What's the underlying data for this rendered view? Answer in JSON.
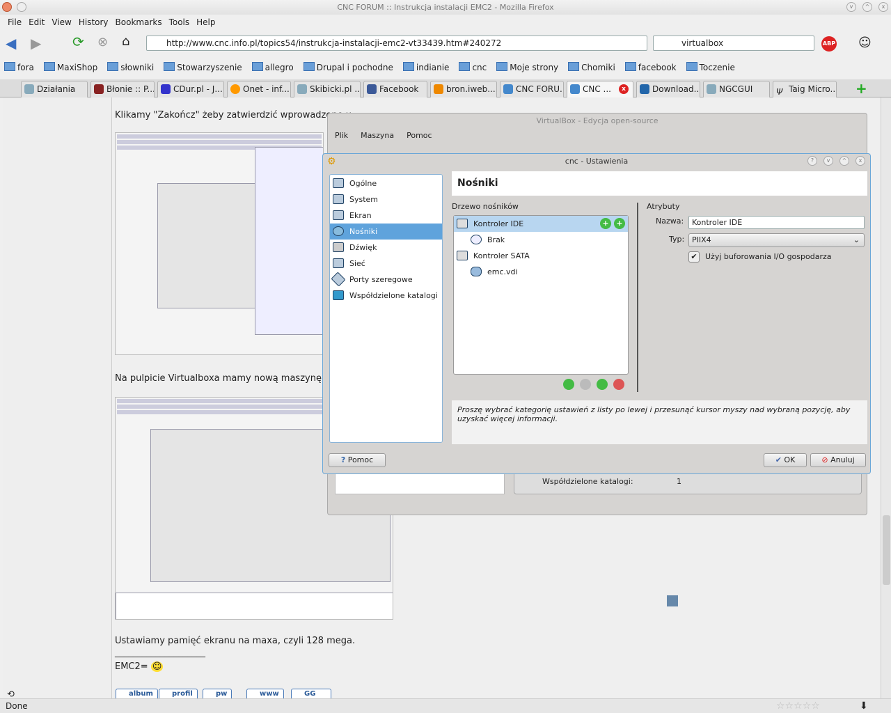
{
  "window": {
    "title": "CNC FORUM :: Instrukcja instalacji EMC2 - Mozilla Firefox"
  },
  "menu": [
    "File",
    "Edit",
    "View",
    "History",
    "Bookmarks",
    "Tools",
    "Help"
  ],
  "nav": {
    "url": "http://www.cnc.info.pl/topics54/instrukcja-instalacji-emc2-vt33439.htm#240272",
    "search": "virtualbox"
  },
  "bookmarks": [
    "fora",
    "MaxiShop",
    "słowniki",
    "Stowarzyszenie",
    "allegro",
    "Drupal i pochodne",
    "indianie",
    "cnc",
    "Moje strony",
    "Chomiki",
    "facebook",
    "Toczenie"
  ],
  "tabs": [
    "Działania",
    "Błonie :: P...",
    "CDur.pl - J...",
    "Onet - inf...",
    "Skibicki.pl ...",
    "Facebook",
    "bron.iweb....",
    "CNC FORU...",
    "CNC ...",
    "Download...",
    "NGCGUI",
    "Taig Micro..."
  ],
  "post": {
    "line1": "Klikamy \"Zakończ\" żeby zatwierdzić wprowadzone u",
    "line2": "Na pulpicie Virtualboxa mamy nową maszynę wirt",
    "line3": "Ustawiamy pamięć ekranu na maxa, czyli 128 mega.",
    "sig_line": "____________________",
    "sig": "EMC2="
  },
  "sig_buttons": [
    "album",
    "profil",
    "pw",
    "www",
    "GG"
  ],
  "status": "Done",
  "vbox": {
    "title": "VirtualBox - Edycja open-source",
    "menu": [
      "Plik",
      "Maszyna",
      "Pomoc"
    ],
    "shared_label": "Współdzielone katalogi:",
    "shared_value": "1"
  },
  "dialog": {
    "title": "cnc - Ustawienia",
    "categories": [
      "Ogólne",
      "System",
      "Ekran",
      "Nośniki",
      "Dźwięk",
      "Sieć",
      "Porty szeregowe",
      "Współdzielone katalogi"
    ],
    "selected": "Nośniki",
    "header": "Nośniki",
    "tree_label": "Drzewo nośników",
    "tree": [
      {
        "label": "Kontroler IDE",
        "level": 0,
        "selected": true
      },
      {
        "label": "Brak",
        "level": 1
      },
      {
        "label": "Kontroler SATA",
        "level": 0
      },
      {
        "label": "emc.vdi",
        "level": 1
      }
    ],
    "attrs_label": "Atrybuty",
    "name_label": "Nazwa:",
    "name_value": "Kontroler IDE",
    "type_label": "Typ:",
    "type_value": "PIIX4",
    "cache_label": "Użyj buforowania I/O gospodarza",
    "cache_checked": true,
    "info": "Proszę wybrać kategorię ustawień z listy po lewej i przesunąć kursor myszy nad wybraną pozycję, aby uzyskać więcej informacji.",
    "help": "Pomoc",
    "ok": "OK",
    "cancel": "Anuluj"
  }
}
